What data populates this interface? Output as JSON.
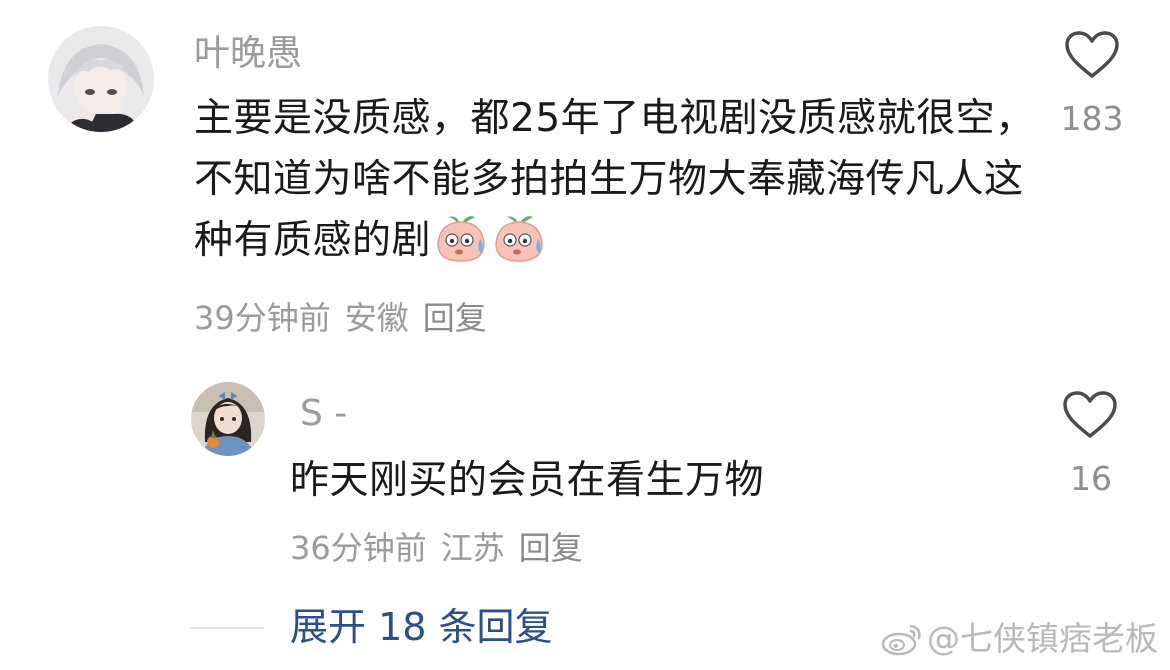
{
  "comments": [
    {
      "username": "叶晚愚",
      "text": "主要是没质感，都25年了电视剧没质感就很空，不知道为啥不能多拍拍生万物大奉藏海传凡人这种有质感的剧",
      "emoji_icons": [
        "sweat-peach-emoji-icon",
        "sweat-peach-emoji-icon"
      ],
      "time": "39分钟前",
      "location": "安徽",
      "reply_label": "回复",
      "likes": "183"
    },
    {
      "username": "S -",
      "text": "昨天刚买的会员在看生万物",
      "time": "36分钟前",
      "location": "江苏",
      "reply_label": "回复",
      "likes": "16"
    }
  ],
  "expand_replies_label": "展开 18 条回复",
  "watermark": "@七侠镇痞老板",
  "colors": {
    "meta_gray": "#9a9a9f",
    "link_blue": "#2b4f8c",
    "text": "#1a1a1a"
  }
}
